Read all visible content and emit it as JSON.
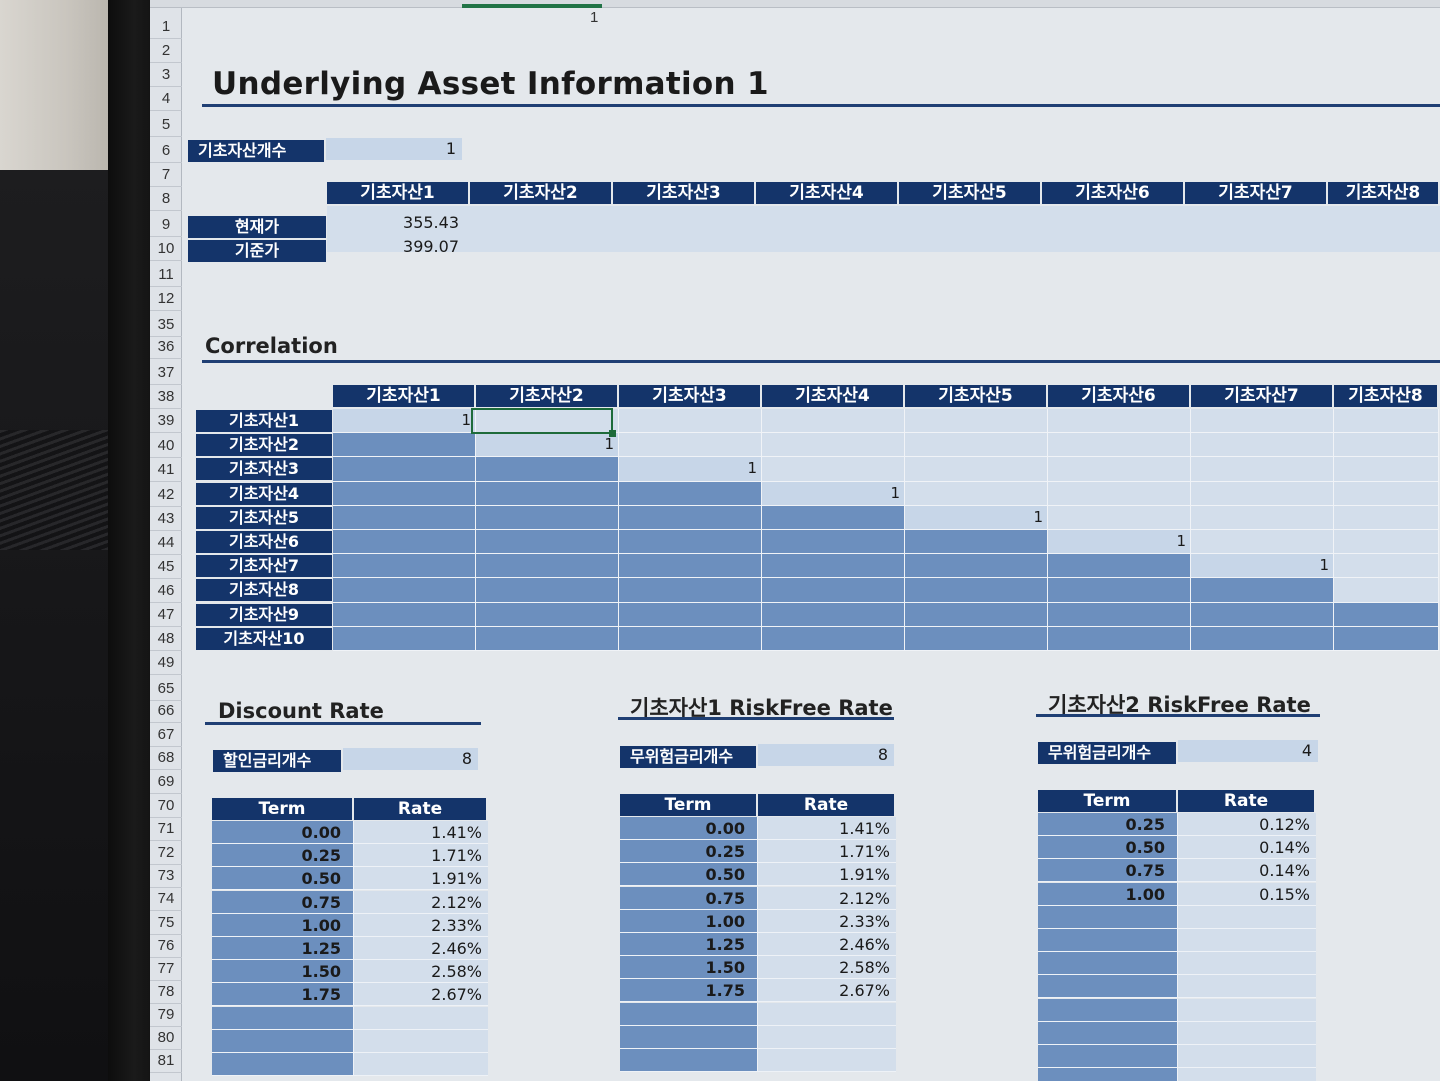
{
  "row1_value": "1",
  "row_numbers": [
    "1",
    "2",
    "3",
    "4",
    "5",
    "6",
    "7",
    "8",
    "9",
    "10",
    "11",
    "12",
    "35",
    "36",
    "37",
    "38",
    "39",
    "40",
    "41",
    "42",
    "43",
    "44",
    "45",
    "46",
    "47",
    "48",
    "49",
    "65",
    "66",
    "67",
    "68",
    "69",
    "70",
    "71",
    "72",
    "73",
    "74",
    "75",
    "76",
    "77",
    "78",
    "79",
    "80",
    "81"
  ],
  "title": "Underlying Asset Information 1",
  "asset_count": {
    "label": "기초자산개수",
    "value": "1"
  },
  "asset_headers": [
    "기초자산1",
    "기초자산2",
    "기초자산3",
    "기초자산4",
    "기초자산5",
    "기초자산6",
    "기초자산7",
    "기초자산8"
  ],
  "price_rows": [
    {
      "label": "현재가",
      "value": "355.43"
    },
    {
      "label": "기준가",
      "value": "399.07"
    }
  ],
  "correlation": {
    "title": "Correlation",
    "col_headers": [
      "기초자산1",
      "기초자산2",
      "기초자산3",
      "기초자산4",
      "기초자산5",
      "기초자산6",
      "기초자산7",
      "기초자산8"
    ],
    "row_labels": [
      "기초자산1",
      "기초자산2",
      "기초자산3",
      "기초자산4",
      "기초자산5",
      "기초자산6",
      "기초자산7",
      "기초자산8",
      "기초자산9",
      "기초자산10"
    ],
    "diagonal_value": "1",
    "diagonal_visible_count": 7
  },
  "discount_rate": {
    "title": "Discount Rate",
    "count_label": "할인금리개수",
    "count_value": "8",
    "headers": [
      "Term",
      "Rate"
    ],
    "rows": [
      [
        "0.00",
        "1.41%"
      ],
      [
        "0.25",
        "1.71%"
      ],
      [
        "0.50",
        "1.91%"
      ],
      [
        "0.75",
        "2.12%"
      ],
      [
        "1.00",
        "2.33%"
      ],
      [
        "1.25",
        "2.46%"
      ],
      [
        "1.50",
        "2.58%"
      ],
      [
        "1.75",
        "2.67%"
      ]
    ]
  },
  "riskfree1": {
    "title": "기초자산1 RiskFree Rate",
    "count_label": "무위험금리개수",
    "count_value": "8",
    "headers": [
      "Term",
      "Rate"
    ],
    "rows": [
      [
        "0.00",
        "1.41%"
      ],
      [
        "0.25",
        "1.71%"
      ],
      [
        "0.50",
        "1.91%"
      ],
      [
        "0.75",
        "2.12%"
      ],
      [
        "1.00",
        "2.33%"
      ],
      [
        "1.25",
        "2.46%"
      ],
      [
        "1.50",
        "2.58%"
      ],
      [
        "1.75",
        "2.67%"
      ]
    ]
  },
  "riskfree2": {
    "title": "기초자산2 RiskFree Rate",
    "count_label": "무위험금리개수",
    "count_value": "4",
    "headers": [
      "Term",
      "Rate"
    ],
    "rows": [
      [
        "0.25",
        "0.12%"
      ],
      [
        "0.50",
        "0.14%"
      ],
      [
        "0.75",
        "0.14%"
      ],
      [
        "1.00",
        "0.15%"
      ]
    ]
  },
  "colors": {
    "header_navy": "#14346a",
    "cell_dark": "#6c8fbe",
    "cell_light": "#d3deeb",
    "selection": "#1e6b3a"
  }
}
